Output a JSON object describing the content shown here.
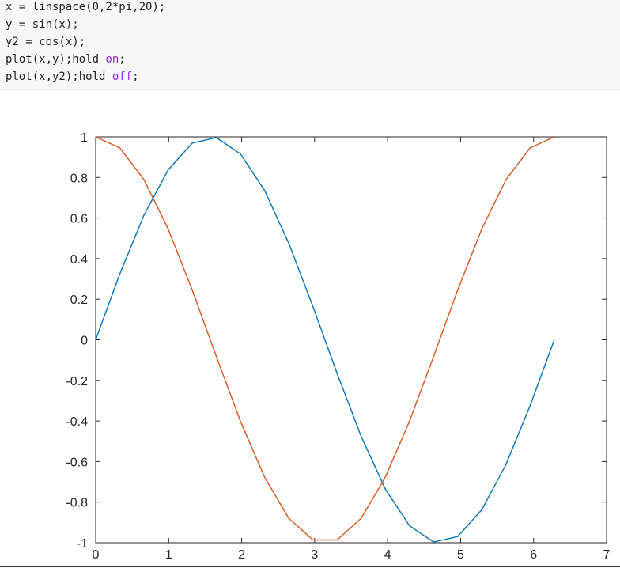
{
  "code": {
    "line1": "x = linspace(0,2*pi,20);",
    "line2": "y = sin(x);",
    "line3": "y2 = cos(x);",
    "line4_pre": "plot(x,y);hold ",
    "line4_kw": "on",
    "line4_post": ";",
    "line5_pre": "plot(x,y2);hold ",
    "line5_kw": "off",
    "line5_post": ";",
    "keyword_color": "#a020f0"
  },
  "chart_data": {
    "type": "line",
    "title": "",
    "xlabel": "",
    "ylabel": "",
    "xlim": [
      0,
      7
    ],
    "ylim": [
      -1,
      1
    ],
    "grid": false,
    "xticks": [
      "0",
      "1",
      "2",
      "3",
      "4",
      "5",
      "6",
      "7"
    ],
    "yticks": [
      "-1",
      "-0.8",
      "-0.6",
      "-0.4",
      "-0.2",
      "0",
      "0.2",
      "0.4",
      "0.6",
      "0.8",
      "1"
    ],
    "x": [
      0,
      0.3307,
      0.6614,
      0.9921,
      1.3228,
      1.6535,
      1.9842,
      2.3149,
      2.6456,
      2.9762,
      3.3069,
      3.6376,
      3.9683,
      4.299,
      4.6297,
      4.9604,
      5.2911,
      5.6218,
      5.9525,
      6.2832
    ],
    "series": [
      {
        "color": "#0072bd",
        "values": [
          0,
          0.3247,
          0.6142,
          0.8372,
          0.9694,
          0.9966,
          0.9158,
          0.7357,
          0.4759,
          0.1646,
          -0.1646,
          -0.4759,
          -0.7357,
          -0.9158,
          -0.9966,
          -0.9694,
          -0.8372,
          -0.6142,
          -0.3247,
          0
        ]
      },
      {
        "color": "#d95319",
        "values": [
          1,
          0.9458,
          0.7891,
          0.5469,
          0.2455,
          -0.0826,
          -0.4017,
          -0.6773,
          -0.8795,
          -0.9864,
          -0.9864,
          -0.8795,
          -0.6773,
          -0.4017,
          -0.0826,
          0.2455,
          0.5469,
          0.7891,
          0.9458,
          1
        ]
      }
    ]
  }
}
